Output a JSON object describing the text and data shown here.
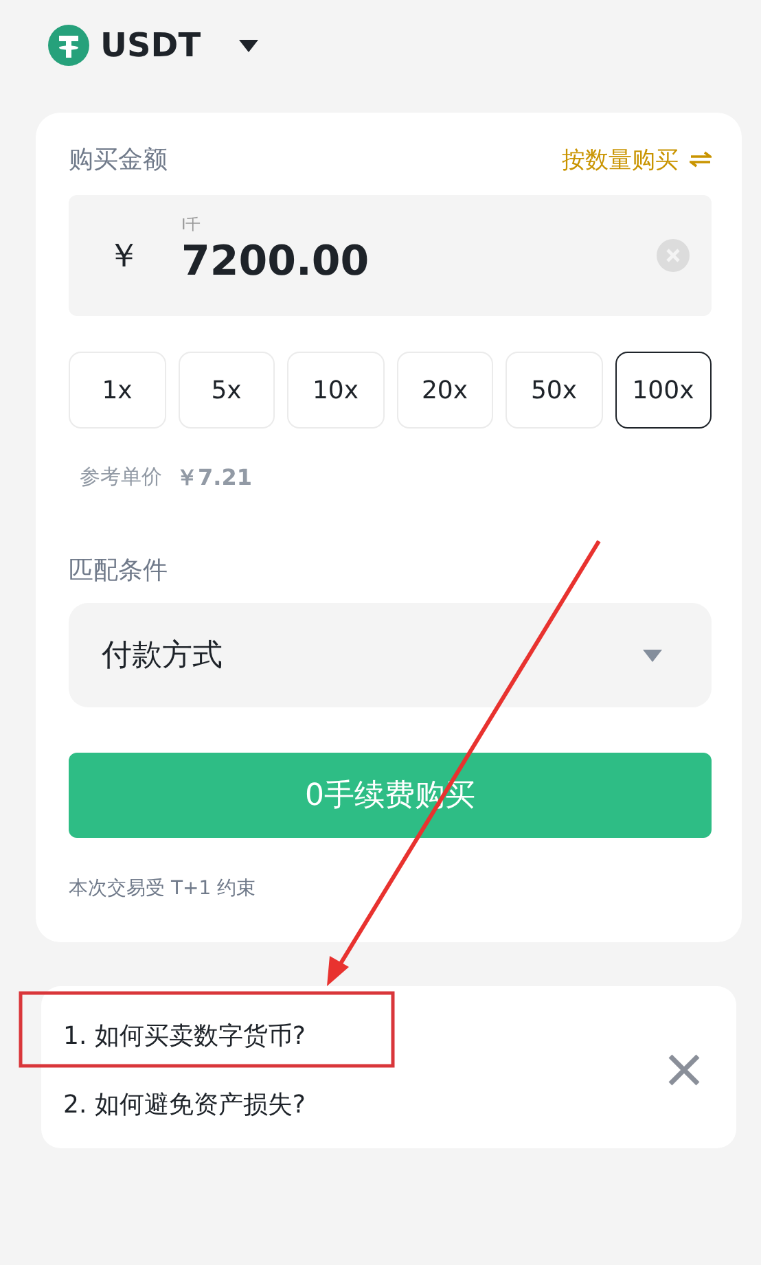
{
  "header": {
    "coin": "USDT"
  },
  "amount": {
    "label": "购买金额",
    "switch_link": "按数量购买",
    "currency": "￥",
    "unit_hint": "I千",
    "value": "7200.00"
  },
  "multipliers": [
    {
      "label": "1x",
      "selected": false
    },
    {
      "label": "5x",
      "selected": false
    },
    {
      "label": "10x",
      "selected": false
    },
    {
      "label": "20x",
      "selected": false
    },
    {
      "label": "50x",
      "selected": false
    },
    {
      "label": "100x",
      "selected": true
    }
  ],
  "reference_price": {
    "label": "参考单价",
    "value": "￥7.21"
  },
  "match": {
    "label": "匹配条件",
    "payment_select": "付款方式"
  },
  "buy_button": "0手续费购买",
  "note": "本次交易受 T+1 约束",
  "tips": [
    "1. 如何买卖数字货币?",
    "2. 如何避免资产损失?"
  ]
}
